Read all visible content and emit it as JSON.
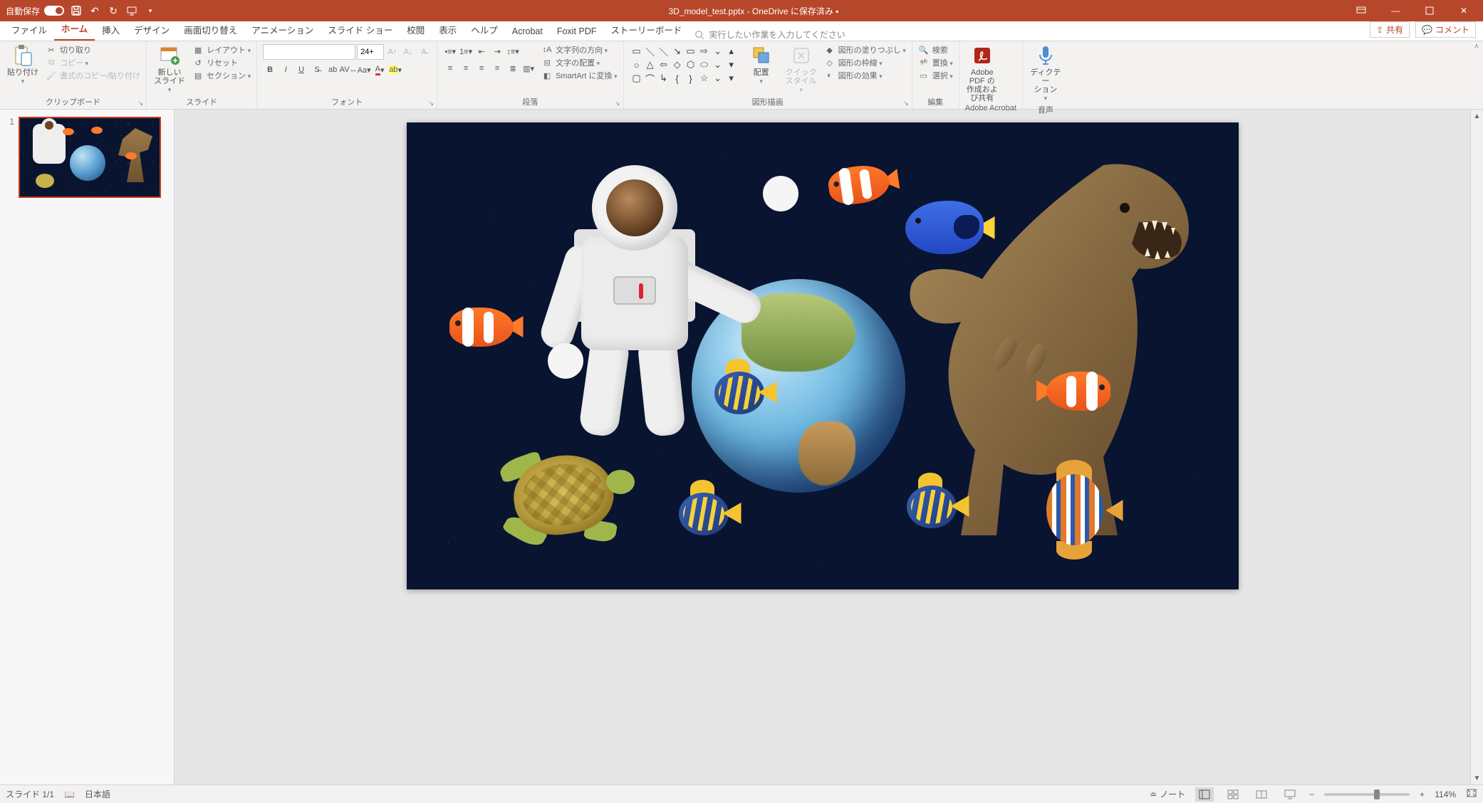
{
  "titlebar": {
    "autosave_label": "自動保存",
    "autosave_state": "オン",
    "filename": "3D_model_test.pptx",
    "save_location_suffix": " - OneDrive に保存済み ▪"
  },
  "tabs": {
    "file": "ファイル",
    "home": "ホーム",
    "insert": "挿入",
    "design": "デザイン",
    "transitions": "画面切り替え",
    "animations": "アニメーション",
    "slideshow": "スライド ショー",
    "review": "校閲",
    "view": "表示",
    "help": "ヘルプ",
    "acrobat": "Acrobat",
    "foxit": "Foxit PDF",
    "storyboard": "ストーリーボード",
    "tell_me_placeholder": "実行したい作業を入力してください",
    "share": "共有",
    "comments": "コメント"
  },
  "ribbon": {
    "clipboard": {
      "paste": "貼り付け",
      "cut": "切り取り",
      "copy": "コピー",
      "format_painter": "書式のコピー/貼り付け",
      "group_label": "クリップボード"
    },
    "slides": {
      "new_slide": "新しい\nスライド",
      "layout": "レイアウト",
      "reset": "リセット",
      "section": "セクション",
      "group_label": "スライド"
    },
    "font": {
      "size_placeholder": "24+",
      "group_label": "フォント"
    },
    "paragraph": {
      "text_direction": "文字列の方向",
      "align_text": "文字の配置",
      "convert_smartart": "SmartArt に変換",
      "group_label": "段落"
    },
    "drawing": {
      "arrange": "配置",
      "quick_styles": "クイック\nスタイル",
      "shape_fill": "図形の塗りつぶし",
      "shape_outline": "図形の枠線",
      "shape_effects": "図形の効果",
      "group_label": "図形描画"
    },
    "editing": {
      "find": "検索",
      "replace": "置換",
      "select": "選択",
      "group_label": "編集"
    },
    "adobe": {
      "button": "Adobe PDF の\n作成および共有",
      "group_label": "Adobe Acrobat"
    },
    "voice": {
      "dictate": "ディクテー\nション",
      "group_label": "音声"
    }
  },
  "slide_panel": {
    "thumbnails": [
      {
        "number": "1"
      }
    ]
  },
  "slide_content": {
    "models": [
      "astronaut",
      "earth",
      "t-rex",
      "clownfish",
      "clownfish",
      "clownfish",
      "blue-tang",
      "sea-turtle",
      "angelfish",
      "angelfish",
      "angelfish",
      "butterflyfish"
    ]
  },
  "statusbar": {
    "slide_counter": "スライド 1/1",
    "language": "日本語",
    "notes": "ノート",
    "zoom_value": "114%"
  }
}
